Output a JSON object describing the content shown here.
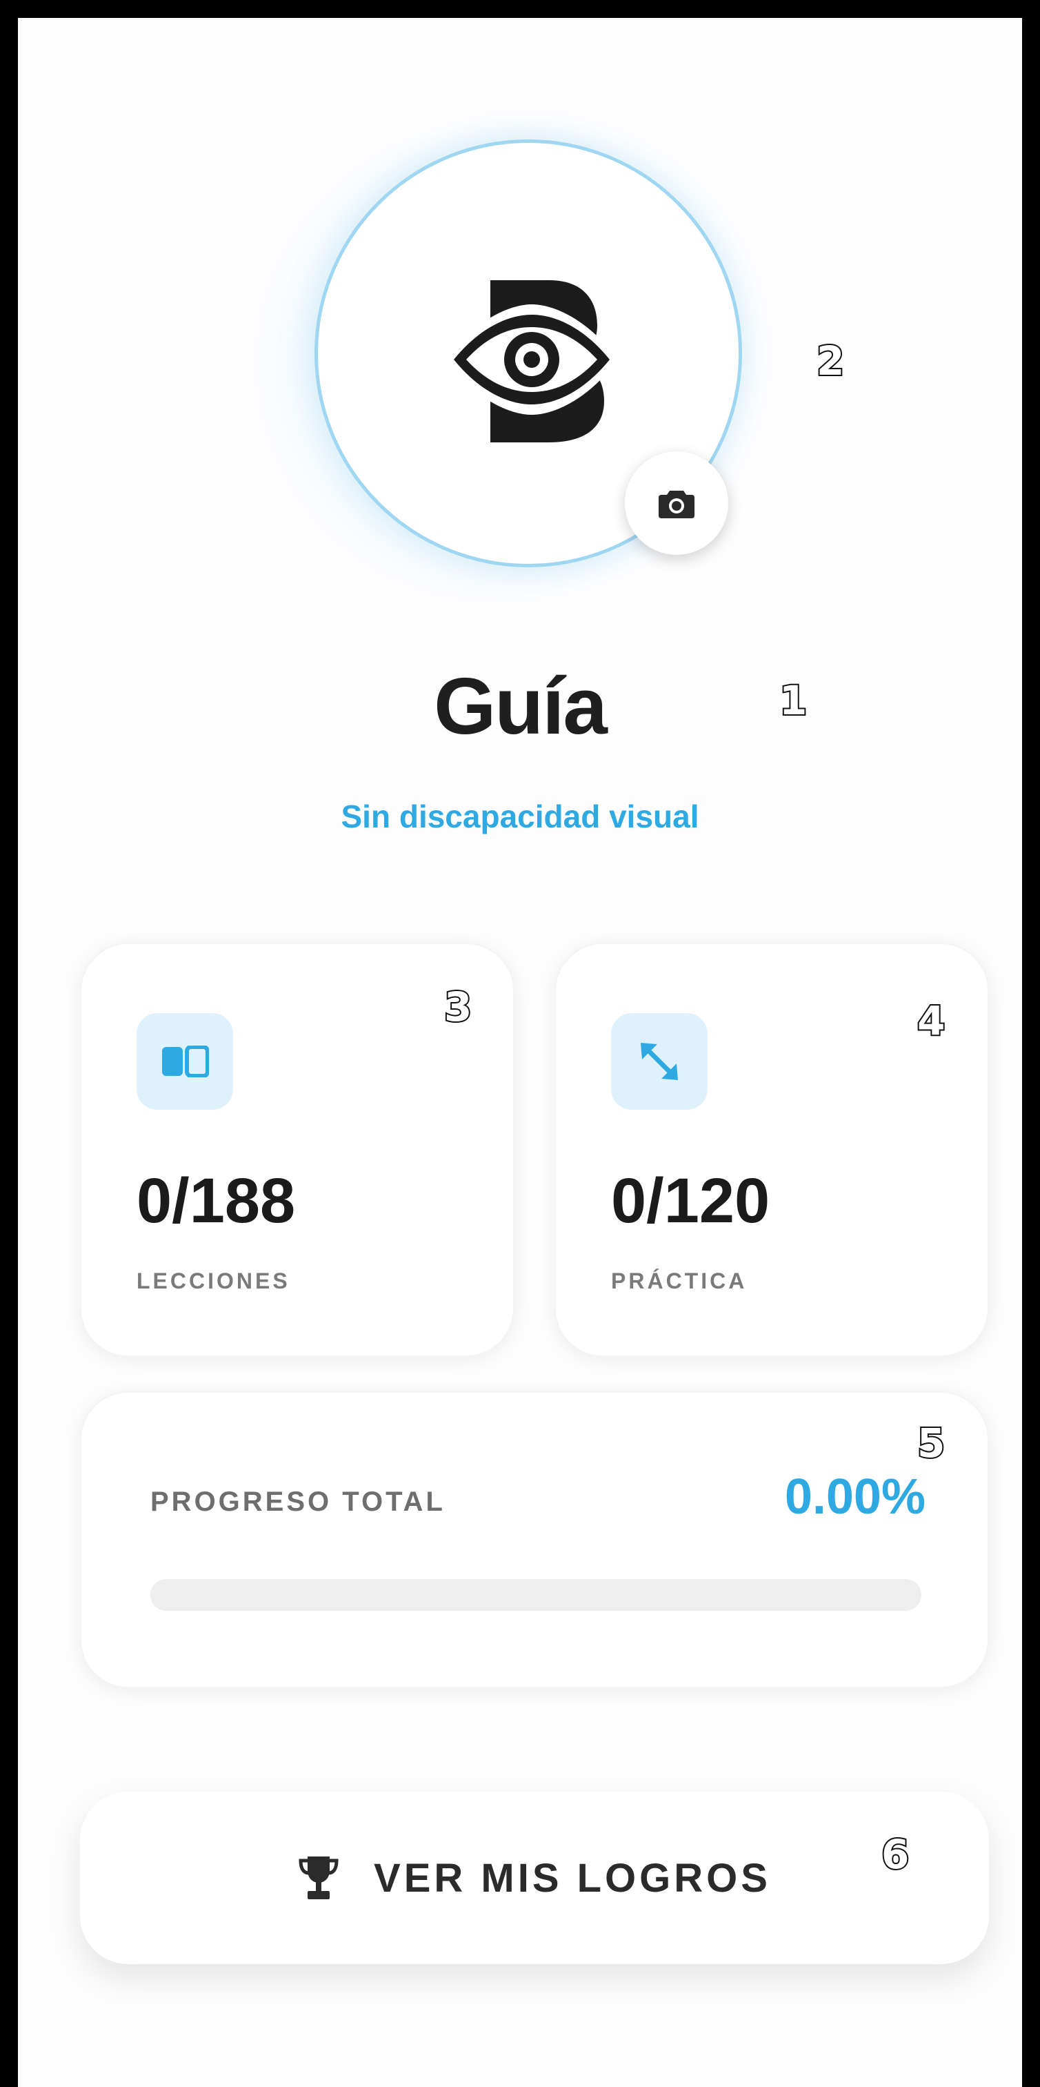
{
  "profile": {
    "name": "Guía",
    "subtitle": "Sin discapacidad visual",
    "avatar_icon": "eye-logo-icon",
    "camera_icon": "camera-icon"
  },
  "stats": [
    {
      "icon": "book-icon",
      "value": "0/188",
      "label": "LECCIONES"
    },
    {
      "icon": "expand-arrows-icon",
      "value": "0/120",
      "label": "PRÁCTICA"
    }
  ],
  "progress": {
    "label": "PROGRESO TOTAL",
    "value_text": "0.00%",
    "value": 0.0
  },
  "achievements_button": {
    "icon": "trophy-icon",
    "label": "VER MIS LOGROS"
  },
  "markers": [
    "1",
    "2",
    "3",
    "4",
    "5",
    "6"
  ],
  "colors": {
    "accent": "#2fa9e1",
    "icon_bg": "#dff2fc",
    "text_dark": "#1f1f1f",
    "label_gray": "#7a7a7a",
    "track": "#eeeeee",
    "frame": "#000000"
  }
}
